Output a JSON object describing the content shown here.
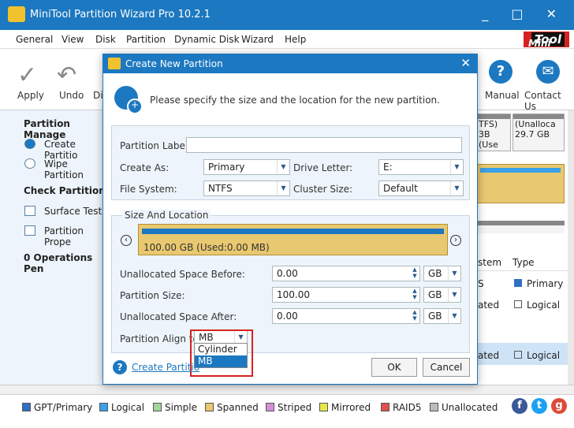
{
  "window": {
    "title": "MiniTool Partition Wizard Pro 10.2.1",
    "controls": "_ □ ✕"
  },
  "menu": [
    "General",
    "View",
    "Disk",
    "Partition",
    "Dynamic Disk",
    "Wizard",
    "Help"
  ],
  "brand": {
    "mini": "Mini",
    "tool": "Tool"
  },
  "toolbar": {
    "apply": "Apply",
    "undo": "Undo",
    "discard_partial": "Di",
    "manual": "Manual",
    "contact": "Contact Us"
  },
  "sidebar": {
    "partition_mgmt": "Partition Manage",
    "create": "Create Partitio",
    "wipe": "Wipe Partition",
    "check": "Check Partition",
    "surface": "Surface Test",
    "properties": "Partition Prope",
    "ops": "0 Operations Pen"
  },
  "right": {
    "tfs": "TFS)",
    "b_use": "3B (Use",
    "unalloc": "(Unalloca",
    "size": "29.7 GB",
    "stem": "stem",
    "type": "Type",
    "s": "S",
    "ated1": "ated",
    "ated2": "ated",
    "primary": "Primary",
    "logical1": "Logical",
    "logical2": "Logical"
  },
  "dialog": {
    "title": "Create New Partition",
    "close": "✕",
    "intro": "Please specify the size and the location for the new partition.",
    "partition_label": "Partition Label:",
    "partition_label_value": "",
    "create_as": "Create As:",
    "create_as_value": "Primary",
    "drive_letter": "Drive Letter:",
    "drive_letter_value": "E:",
    "file_system": "File System:",
    "file_system_value": "NTFS",
    "cluster_size": "Cluster Size:",
    "cluster_size_value": "Default",
    "size_location": "Size And Location",
    "bar_text": "100.00 GB (Used:0.00 MB)",
    "unalloc_before": "Unallocated Space Before:",
    "unalloc_before_value": "0.00",
    "partition_size": "Partition Size:",
    "partition_size_value": "100.00",
    "unalloc_after": "Unallocated Space After:",
    "unalloc_after_value": "0.00",
    "unit": "GB",
    "align_to": "Partition Align to:",
    "align_value": "MB",
    "align_options": [
      "Cylinder",
      "MB"
    ],
    "help_link": "Create Partitio",
    "ok": "OK",
    "cancel": "Cancel"
  },
  "legend": [
    {
      "label": "GPT/Primary",
      "color": "#2f6fc4"
    },
    {
      "label": "Logical",
      "color": "#3aa0e8"
    },
    {
      "label": "Simple",
      "color": "#9fd69a"
    },
    {
      "label": "Spanned",
      "color": "#e8c870"
    },
    {
      "label": "Striped",
      "color": "#d48fd6"
    },
    {
      "label": "Mirrored",
      "color": "#e8e64a"
    },
    {
      "label": "RAID5",
      "color": "#e05050"
    },
    {
      "label": "Unallocated",
      "color": "#bdbdbd"
    }
  ],
  "colors": {
    "accent": "#1c78c0",
    "brand_red": "#d62222"
  }
}
